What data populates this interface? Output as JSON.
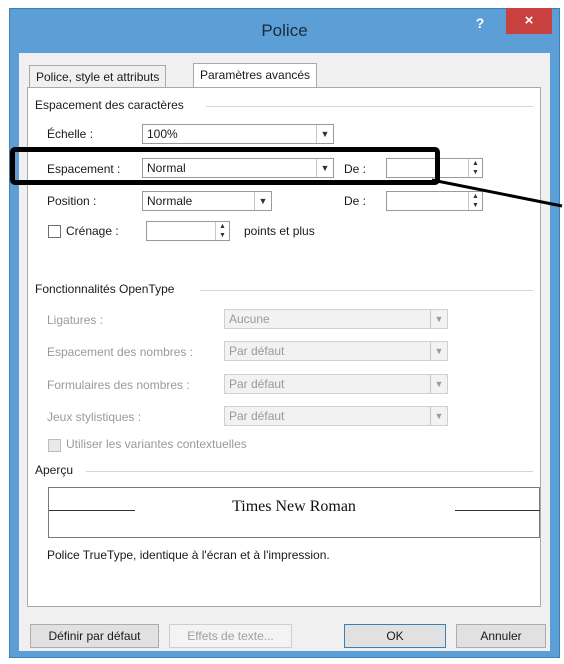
{
  "window": {
    "title": "Police",
    "help": "?",
    "close": "×"
  },
  "tabs": [
    {
      "label": "Police, style et attributs"
    },
    {
      "label": "Paramètres avancés"
    }
  ],
  "spacing_group": {
    "title": "Espacement des caractères",
    "scale": {
      "label": "Échelle :",
      "value": "100%"
    },
    "spacing": {
      "label": "Espacement :",
      "value": "Normal",
      "de_label": "De :",
      "de_value": ""
    },
    "position": {
      "label": "Position :",
      "value": "Normale",
      "de_label": "De :",
      "de_value": ""
    },
    "kerning": {
      "label": "Crénage :",
      "value": "",
      "suffix": "points et plus",
      "checked": false
    }
  },
  "opentype_group": {
    "title": "Fonctionnalités OpenType",
    "ligatures": {
      "label": "Ligatures :",
      "value": "Aucune"
    },
    "number_spacing": {
      "label": "Espacement des nombres :",
      "value": "Par défaut"
    },
    "number_forms": {
      "label": "Formulaires des nombres :",
      "value": "Par défaut"
    },
    "stylistic_sets": {
      "label": "Jeux stylistiques :",
      "value": "Par défaut"
    },
    "contextual": {
      "label": "Utiliser les variantes contextuelles",
      "checked": false
    }
  },
  "preview_group": {
    "title": "Aperçu",
    "sample": "Times New Roman",
    "note": "Police TrueType, identique à l'écran et à l'impression."
  },
  "buttons": {
    "set_default": "Définir par défaut",
    "text_effects": "Effets de texte...",
    "ok": "OK",
    "cancel": "Annuler"
  },
  "colors": {
    "titlebar": "#5b9fd6",
    "close": "#c9413e",
    "annotation": "#000000"
  }
}
